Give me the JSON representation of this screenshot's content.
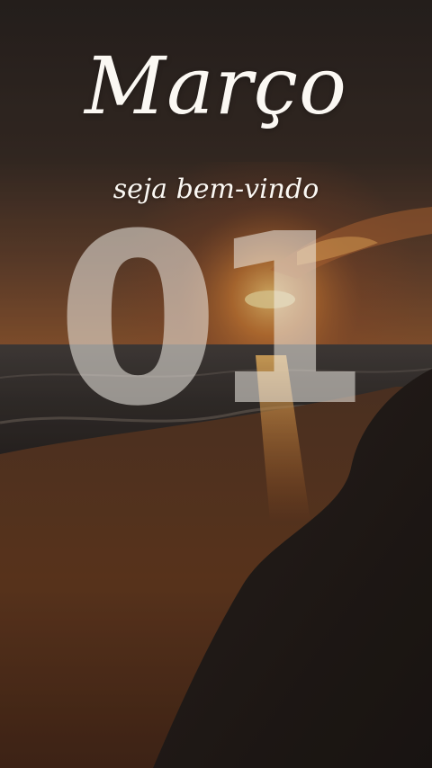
{
  "title": "Março",
  "subtitle": "seja bem-vindo",
  "day": "01",
  "colors": {
    "sky_top": "#2c2522",
    "sun": "#f0b060",
    "sea": "#3a3430",
    "sand": "#5a3420",
    "text": "#fbf8f3"
  }
}
